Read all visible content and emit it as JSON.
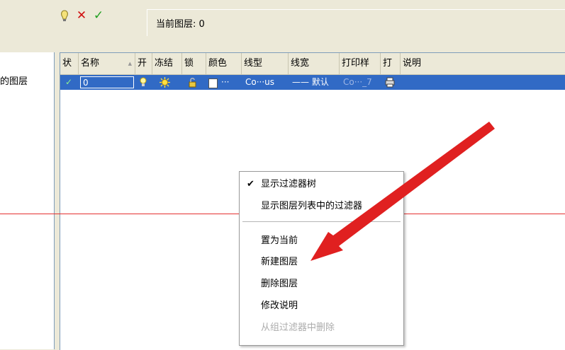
{
  "toolbar": {
    "icons": [
      "new-layer-icon",
      "delete-icon",
      "set-current-icon"
    ],
    "current_layer_label": "当前图层: 0"
  },
  "tree": {
    "item_label": "的图层"
  },
  "layer_table": {
    "headers": [
      "状",
      "名称",
      "开",
      "冻结",
      "锁",
      "颜色",
      "线型",
      "线宽",
      "打印样",
      "打",
      "说明"
    ],
    "row": {
      "status": "✓",
      "name": "0",
      "color_text": "···",
      "linetype": "Co···us",
      "lineweight": "—— 默认",
      "plot_style": "Co···_7"
    }
  },
  "context_menu": {
    "items": [
      {
        "label": "显示过滤器树",
        "checked": true,
        "disabled": false
      },
      {
        "label": "显示图层列表中的过滤器",
        "checked": false,
        "disabled": false
      },
      {
        "label": "置为当前",
        "checked": false,
        "disabled": false
      },
      {
        "label": "新建图层",
        "checked": false,
        "disabled": false
      },
      {
        "label": "删除图层",
        "checked": false,
        "disabled": false
      },
      {
        "label": "修改说明",
        "checked": false,
        "disabled": false
      },
      {
        "label": "从组过滤器中删除",
        "checked": false,
        "disabled": true
      }
    ]
  },
  "colors": {
    "selection": "#316ac5",
    "annotation_arrow": "#e02020",
    "guide_line": "#e53030"
  }
}
